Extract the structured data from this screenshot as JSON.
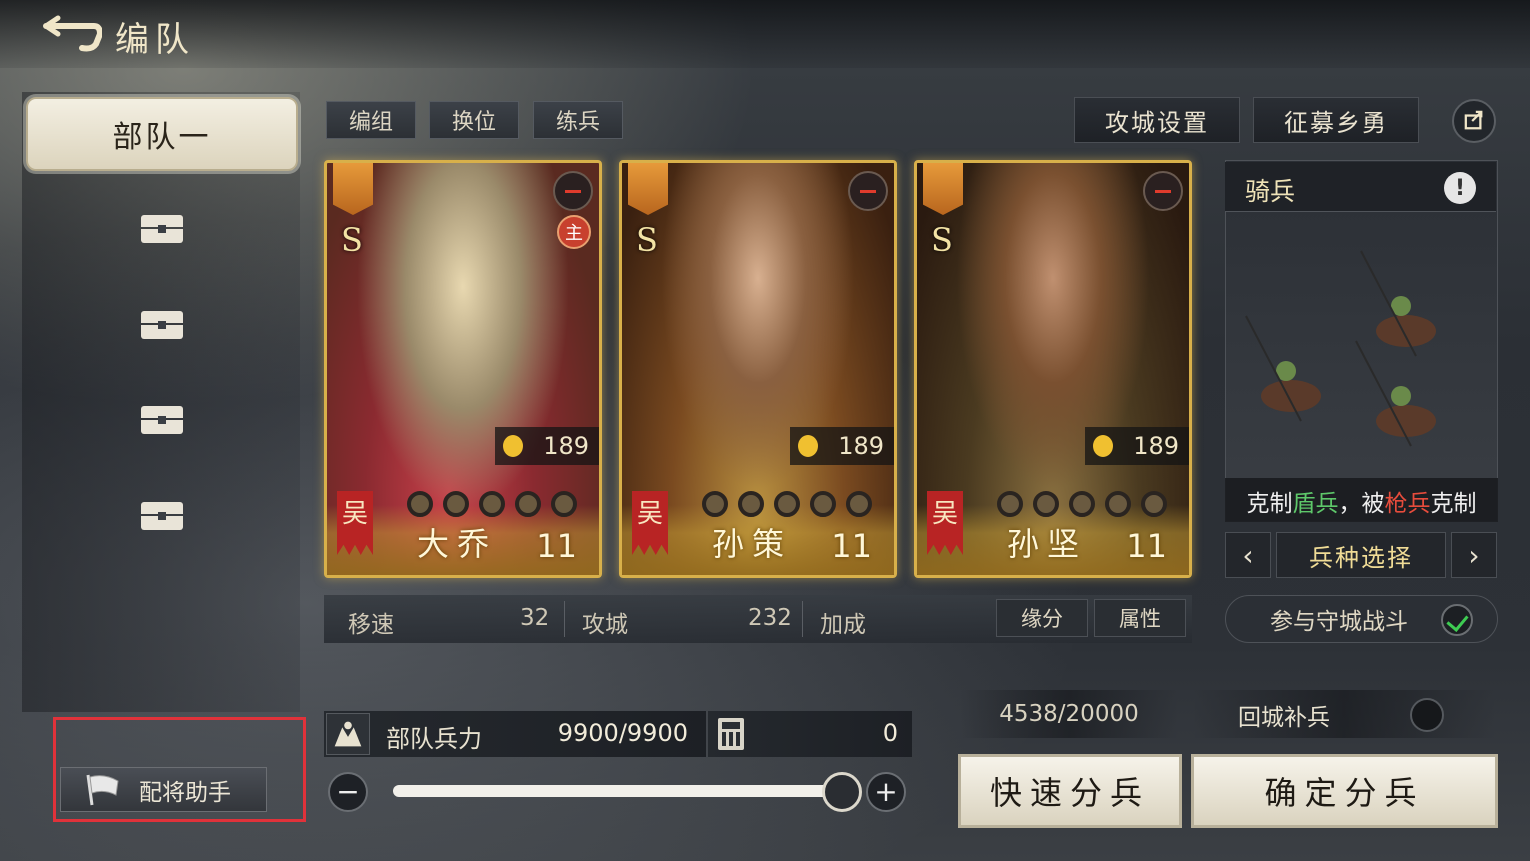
{
  "header": {
    "title": "编队"
  },
  "sidebar": {
    "active_troop": "部队一"
  },
  "helper": {
    "label": "配将助手"
  },
  "tabs": [
    "编组",
    "换位",
    "练兵"
  ],
  "actions": {
    "siege_settings": "攻城设置",
    "recruit": "征募乡勇"
  },
  "cards": [
    {
      "name": "大乔",
      "level": "11",
      "grade": "S",
      "cost": "189",
      "faction": "吴",
      "leader_badge": "主"
    },
    {
      "name": "孙策",
      "level": "11",
      "grade": "S",
      "cost": "189",
      "faction": "吴"
    },
    {
      "name": "孙坚",
      "level": "11",
      "grade": "S",
      "cost": "189",
      "faction": "吴"
    }
  ],
  "stats": {
    "speed_label": "移速",
    "speed_value": "32",
    "siege_label": "攻城",
    "siege_value": "232",
    "bonus_label": "加成",
    "fate_button": "缘分",
    "attr_button": "属性"
  },
  "unit": {
    "title": "骑兵",
    "info": "!",
    "counter_prefix": "克制",
    "counter_strong": "盾兵",
    "counter_mid": "，被",
    "counter_weak": "枪兵",
    "counter_suffix": "克制",
    "select_label": "兵种选择",
    "prev": "‹",
    "next": "›"
  },
  "defend": {
    "label": "参与守城战斗",
    "checked": true
  },
  "troops": {
    "label": "部队兵力",
    "value": "9900/9900",
    "extra": "0",
    "slider_fraction": 1.0,
    "minus": "−",
    "plus": "+"
  },
  "reserve": {
    "value": "4538/20000",
    "return_label": "回城补兵"
  },
  "buttons": {
    "quick": "快速分兵",
    "confirm": "确定分兵"
  },
  "colors": {
    "accent_gold": "#d8b04a",
    "counter_green": "#5ec86a",
    "counter_red": "#e74c3c",
    "highlight_frame": "#e0323a"
  }
}
